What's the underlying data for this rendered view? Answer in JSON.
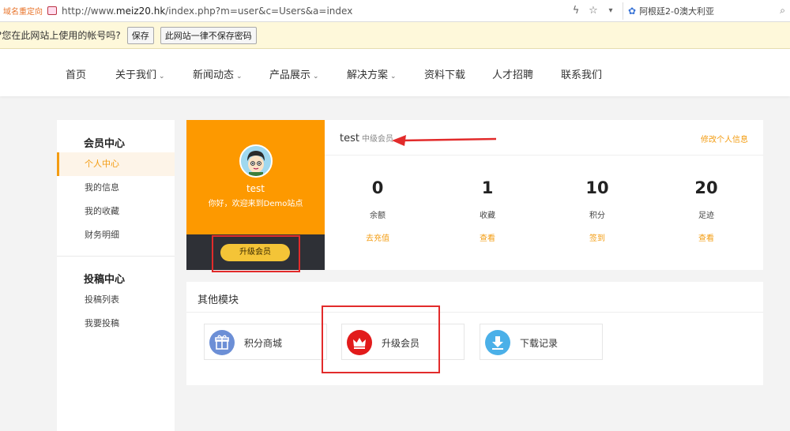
{
  "browser": {
    "redirect_label": "域名重定向",
    "url_prefix": "http://www.",
    "url_domain": "meiz20.hk",
    "url_path": "/index.php?m=user&c=Users&a=index",
    "search_text": "阿根廷2-0澳大利亚"
  },
  "password_bar": {
    "question": "?您在此网站上使用的帐号吗?",
    "save_label": "保存",
    "never_label": "此网站一律不保存密码"
  },
  "nav": {
    "items": [
      {
        "label": "首页",
        "dropdown": false
      },
      {
        "label": "关于我们",
        "dropdown": true
      },
      {
        "label": "新闻动态",
        "dropdown": true
      },
      {
        "label": "产品展示",
        "dropdown": true
      },
      {
        "label": "解决方案",
        "dropdown": true
      },
      {
        "label": "资料下载",
        "dropdown": false
      },
      {
        "label": "人才招聘",
        "dropdown": false
      },
      {
        "label": "联系我们",
        "dropdown": false
      }
    ],
    "caret": "⌄"
  },
  "sidebar": {
    "member_heading": "会员中心",
    "member_items": [
      "个人中心",
      "我的信息",
      "我的收藏",
      "财务明细"
    ],
    "submit_heading": "投稿中心",
    "submit_items": [
      "投稿列表",
      "我要投稿"
    ]
  },
  "profile": {
    "username": "test",
    "welcome": "你好，欢迎来到Demo站点",
    "upgrade_label": "升级会员"
  },
  "stats": {
    "user": "test",
    "level": "中级会员",
    "edit_label": "修改个人信息",
    "items": [
      {
        "value": "0",
        "label": "余额",
        "action": "去充值"
      },
      {
        "value": "1",
        "label": "收藏",
        "action": "查看"
      },
      {
        "value": "10",
        "label": "积分",
        "action": "签到"
      },
      {
        "value": "20",
        "label": "足迹",
        "action": "查看"
      }
    ]
  },
  "modules": {
    "title": "其他模块",
    "items": [
      {
        "label": "积分商城",
        "icon": "gift-icon",
        "color": "#6c8fd6"
      },
      {
        "label": "升级会员",
        "icon": "crown-icon",
        "color": "#e21b1b"
      },
      {
        "label": "下载记录",
        "icon": "download-icon",
        "color": "#4bb0e8"
      }
    ]
  },
  "colors": {
    "accent": "#f39c12",
    "profile_bg": "#fd9900",
    "annotation": "#e22b2b"
  }
}
